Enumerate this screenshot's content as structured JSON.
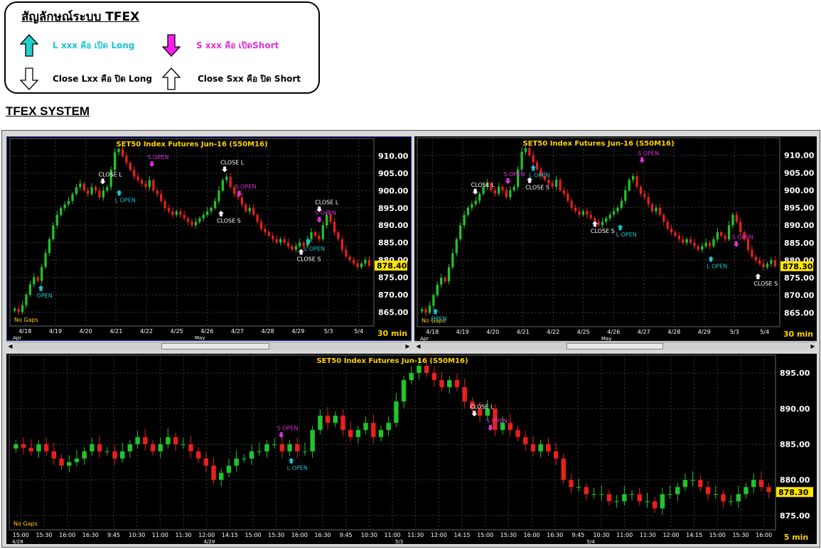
{
  "legend": {
    "title": "สัญลักษณ์ระบบ TFEX",
    "long_open": "L xxx คือ เปิด Long",
    "short_open": "S xxx คือ เปิดShort",
    "close_long": "Close Lxx คือ ปิด Long",
    "close_short": "Close Sxx คือ ปิด Short"
  },
  "section_title": "TFEX SYSTEM",
  "colors": {
    "up": "#22c42a",
    "down": "#e8201c",
    "bg": "#000000",
    "grid": "#3a3a3a",
    "axis": "#ffffff",
    "title": "#ffd200",
    "long": "#18c6d6",
    "short": "#e030d8",
    "close": "#ffffff"
  },
  "icons": [
    "arrow-up-cyan-icon",
    "arrow-down-magenta-icon",
    "arrow-down-outline-icon",
    "arrow-up-outline-icon"
  ],
  "chart_data": [
    {
      "type": "candlestick",
      "title": "SET50  Index  Futures  Jun-16  (S50M16)",
      "interval": "30  min",
      "gap_note": "No  Gaps",
      "last_price": "878.40",
      "ylim": [
        861,
        915
      ],
      "y_ticks": [
        "910.00",
        "905.00",
        "900.00",
        "895.00",
        "890.00",
        "885.00",
        "880.00",
        "875.00",
        "870.00",
        "865.00"
      ],
      "x_ticks": [
        "4/18",
        "4/19",
        "4/20",
        "4/21",
        "4/22",
        "4/25",
        "4/26",
        "4/27",
        "4/28",
        "4/29",
        "5/3",
        "5/4"
      ],
      "x_sub": [
        "Apr",
        "May"
      ],
      "close": [
        866,
        865,
        867,
        870,
        873,
        875,
        874,
        878,
        882,
        886,
        890,
        893,
        895,
        896,
        897,
        899,
        901,
        902,
        900,
        899,
        901,
        900,
        898,
        900,
        901,
        906,
        911,
        912,
        910,
        908,
        906,
        904,
        903,
        902,
        901,
        903,
        900,
        899,
        897,
        895,
        894,
        893,
        894,
        893,
        892,
        891,
        890,
        891,
        892,
        893,
        894,
        895,
        897,
        900,
        903,
        904,
        901,
        899,
        898,
        896,
        894,
        895,
        893,
        891,
        889,
        888,
        887,
        886,
        885,
        886,
        885,
        884,
        883,
        884,
        885,
        884,
        886,
        888,
        887,
        886,
        890,
        893,
        891,
        888,
        886,
        883,
        881,
        880,
        879,
        878,
        879,
        880,
        878.4
      ],
      "signals": [
        {
          "label": "OPEN",
          "kind": "long",
          "x": 0.085,
          "y": 872.5
        },
        {
          "label": "CLOSE  L",
          "kind": "close-long",
          "x": 0.255,
          "y": 902
        },
        {
          "label": "L  OPEN",
          "kind": "long",
          "x": 0.3,
          "y": 900
        },
        {
          "label": "S  OPEN",
          "kind": "short",
          "x": 0.39,
          "y": 907
        },
        {
          "label": "CLOSE  L",
          "kind": "close-long",
          "x": 0.59,
          "y": 905.5
        },
        {
          "label": "S  OPEN",
          "kind": "short",
          "x": 0.63,
          "y": 898.5
        },
        {
          "label": "CLOSE  S",
          "kind": "close-short",
          "x": 0.58,
          "y": 894
        },
        {
          "label": "CLOSE  L",
          "kind": "close-long",
          "x": 0.85,
          "y": 894
        },
        {
          "label": "S  OPEN",
          "kind": "short",
          "x": 0.85,
          "y": 891
        },
        {
          "label": "L  OPEN",
          "kind": "long",
          "x": 0.82,
          "y": 886
        },
        {
          "label": "CLOSE  S",
          "kind": "close-short",
          "x": 0.8,
          "y": 883
        }
      ]
    },
    {
      "type": "candlestick",
      "title": "SET50  Index  Futures  Jun-16  (S50M16)",
      "interval": "30  min",
      "gap_note": "No  Gaps",
      "last_price": "878.30",
      "ylim": [
        861,
        915
      ],
      "y_ticks": [
        "910.00",
        "905.00",
        "900.00",
        "895.00",
        "890.00",
        "885.00",
        "880.00",
        "875.00",
        "870.00",
        "865.00"
      ],
      "x_ticks": [
        "4/18",
        "4/19",
        "4/20",
        "4/21",
        "4/22",
        "4/25",
        "4/26",
        "4/27",
        "4/28",
        "4/29",
        "5/3",
        "5/4"
      ],
      "x_sub": [
        "Apr",
        "May"
      ],
      "close": [
        866,
        865,
        867,
        870,
        873,
        875,
        874,
        878,
        882,
        886,
        890,
        893,
        895,
        896,
        897,
        899,
        901,
        902,
        900,
        899,
        901,
        900,
        898,
        900,
        901,
        906,
        911,
        912,
        910,
        908,
        906,
        904,
        903,
        902,
        901,
        903,
        900,
        899,
        897,
        895,
        894,
        893,
        894,
        893,
        892,
        891,
        890,
        891,
        892,
        893,
        894,
        895,
        897,
        900,
        903,
        904,
        901,
        899,
        898,
        896,
        894,
        895,
        893,
        891,
        889,
        888,
        887,
        886,
        885,
        886,
        885,
        884,
        883,
        884,
        885,
        884,
        886,
        888,
        887,
        886,
        890,
        893,
        891,
        888,
        886,
        883,
        881,
        880,
        879,
        878,
        879,
        880,
        878.3
      ],
      "signals": [
        {
          "label": "OPEN",
          "kind": "long",
          "x": 0.05,
          "y": 866
        },
        {
          "label": "CLOSE  L",
          "kind": "close-long",
          "x": 0.16,
          "y": 899
        },
        {
          "label": "S  OPEN",
          "kind": "short",
          "x": 0.25,
          "y": 902
        },
        {
          "label": "L  OPEN",
          "kind": "long",
          "x": 0.32,
          "y": 907
        },
        {
          "label": "CLOSE  S",
          "kind": "close-short",
          "x": 0.31,
          "y": 903.5
        },
        {
          "label": "S  OPEN",
          "kind": "short",
          "x": 0.62,
          "y": 908
        },
        {
          "label": "CLOSE  S",
          "kind": "close-short",
          "x": 0.49,
          "y": 891
        },
        {
          "label": "L  OPEN",
          "kind": "long",
          "x": 0.56,
          "y": 890
        },
        {
          "label": "L  OPEN",
          "kind": "long",
          "x": 0.81,
          "y": 881
        },
        {
          "label": "S  OPEN",
          "kind": "short",
          "x": 0.88,
          "y": 884
        },
        {
          "label": "CLOSE  S",
          "kind": "close-short",
          "x": 0.94,
          "y": 876
        }
      ]
    },
    {
      "type": "candlestick",
      "title": "SET50  Index  Futures  Jun-16  (S50M16)",
      "interval": "5  min",
      "gap_note": "No  Gaps",
      "last_price": "878.30",
      "ylim": [
        873,
        897.5
      ],
      "y_ticks": [
        "895.00",
        "890.00",
        "885.00",
        "880.00",
        "875.00"
      ],
      "x_ticks": [
        "15:00",
        "15:30",
        "16:00",
        "16:30",
        "9:45",
        "10:30",
        "11:00",
        "11:30",
        "12:00",
        "14:15",
        "15:00",
        "15:30",
        "16:00",
        "16:30",
        "9:45",
        "10:30",
        "11:00",
        "11:30",
        "12:00",
        "14:15",
        "15:00",
        "15:30",
        "16:00",
        "16:30",
        "9:45",
        "10:30",
        "11:00",
        "11:30",
        "12:00",
        "14:15",
        "15:00",
        "15:30",
        "16:00"
      ],
      "x_sub": [
        "4/28",
        "4/29",
        "5/3",
        "5/4"
      ],
      "close": [
        885,
        884.5,
        884,
        885,
        884,
        883,
        882,
        882.5,
        883,
        884,
        885,
        884,
        884,
        883,
        884,
        885,
        886,
        885,
        884,
        885,
        886,
        885,
        885,
        884,
        883,
        882,
        880,
        881,
        882,
        883,
        883,
        884,
        884,
        885,
        885,
        884,
        885,
        884,
        884,
        887,
        889,
        888,
        889,
        887,
        886,
        887,
        888,
        886,
        887,
        888,
        891,
        894,
        895,
        896,
        895,
        894,
        893,
        894,
        893,
        891,
        890,
        889,
        890,
        887,
        888,
        887,
        886,
        885,
        884,
        885,
        884,
        883,
        880,
        879,
        879,
        878,
        878,
        878,
        877,
        877,
        878,
        878,
        877,
        877,
        876,
        878,
        878,
        879,
        880,
        880,
        879,
        878,
        878,
        877,
        877,
        878,
        879,
        880,
        879,
        878.3
      ],
      "signals": [
        {
          "label": "CLOSE  L",
          "kind": "close-long",
          "x": 0.607,
          "y": 889
        },
        {
          "label": "S  OPEN",
          "kind": "short",
          "x": 0.628,
          "y": 887
        },
        {
          "label": "S  OPEN",
          "kind": "short",
          "x": 0.355,
          "y": 886
        },
        {
          "label": "L  OPEN",
          "kind": "long",
          "x": 0.368,
          "y": 883
        }
      ]
    }
  ]
}
